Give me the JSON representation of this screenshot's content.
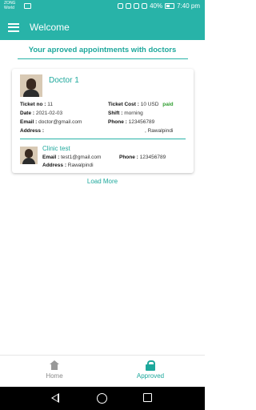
{
  "status_bar": {
    "carrier": "ZONG\nWorld",
    "battery": "40%",
    "time": "7:40 pm"
  },
  "app_bar": {
    "title": "Welcome"
  },
  "heading": "Your aproved appointments with doctors",
  "appointment": {
    "doctor_name": "Doctor 1",
    "ticket_no_label": "Ticket no :",
    "ticket_no": "11",
    "ticket_cost_label": "Ticket Cost :",
    "ticket_cost": "10 USD",
    "payment_status": "paid",
    "date_label": "Date :",
    "date": "2021-02-03",
    "shift_label": "Shift :",
    "shift": "morning",
    "email_label": "Email :",
    "email": "doctor@gmail.com",
    "phone_label": "Phone :",
    "phone": "123456789",
    "address_label": "Address :",
    "address": ", Rawalpindi",
    "clinic": {
      "name": "Clinic test",
      "email_label": "Email :",
      "email": "test1@gmail.com",
      "phone_label": "Phone :",
      "phone": "123456789",
      "address_label": "Address :",
      "address": "Rawalpindi"
    }
  },
  "load_more": "Load More",
  "bottom_nav": {
    "home_label": "Home",
    "approved_label": "Approved"
  },
  "colors": {
    "primary": "#28b3a8",
    "accent": "#1ea89c",
    "paid": "#2e9d2e"
  }
}
